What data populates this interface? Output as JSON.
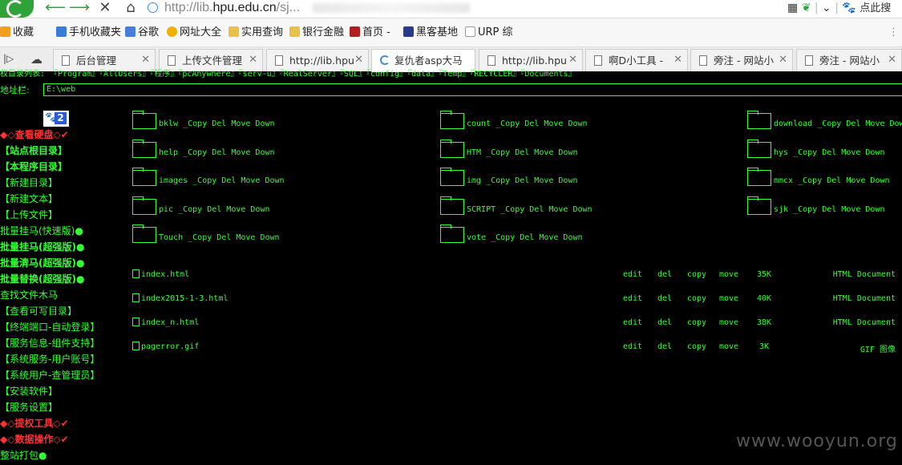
{
  "browser": {
    "url_host_prefix": "http://lib.",
    "url_host_main": "hpu.edu.cn",
    "url_tail": "/sj...",
    "search_placeholder": "点此搜",
    "bookmarks": [
      {
        "label": "收藏",
        "color": "#f0a020"
      },
      {
        "label": "手机收藏夹",
        "color": "#3a7bd5"
      },
      {
        "label": "谷歌",
        "color": "#4a7fd9"
      },
      {
        "label": "网址大全",
        "color": "#f0b000"
      },
      {
        "label": "实用查询",
        "color": "#e8c050"
      },
      {
        "label": "银行金融",
        "color": "#e8c050"
      },
      {
        "label": "首页 -",
        "color": "#b02020"
      },
      {
        "label": "黑客基地",
        "color": "#2a3a8a"
      },
      {
        "label": "URP 综",
        "color": "#999999"
      }
    ],
    "tabs": [
      {
        "label": "后台管理",
        "active": false
      },
      {
        "label": "上传文件管理",
        "active": false
      },
      {
        "label": "http://lib.hpu",
        "active": false
      },
      {
        "label": "复仇者asp大马",
        "active": true
      },
      {
        "label": "http://lib.hpu",
        "active": false
      },
      {
        "label": "啊D小工具 -",
        "active": false
      },
      {
        "label": "旁注 - 网站小",
        "active": false
      },
      {
        "label": "旁注 - 网站小",
        "active": false
      }
    ]
  },
  "page": {
    "dir_list": "权目录列表: 『Program』『AllUsers』『程序』『pcAnywhere』『serv-u』『RealServer』『SQL』『config』『data』『Temp』『RECYCLER』『Documents』",
    "address_label": "地址栏:",
    "address_value": "E:\\web",
    "badge": "2",
    "sidebar": [
      {
        "label": "◆◇查看硬盘◇✔",
        "style": "red"
      },
      {
        "label": "【站点根目录】",
        "style": "bold"
      },
      {
        "label": "【本程序目录】",
        "style": "bold"
      },
      {
        "label": "【新建目录】",
        "style": "normal"
      },
      {
        "label": "【新建文本】",
        "style": "normal"
      },
      {
        "label": "【上传文件】",
        "style": "normal"
      },
      {
        "label": "批量挂马(快速版)●",
        "style": "normal"
      },
      {
        "label": "批量挂马(超强版)●",
        "style": "bold"
      },
      {
        "label": "批量清马(超强版)●",
        "style": "bold"
      },
      {
        "label": "批量替换(超强版)●",
        "style": "bold"
      },
      {
        "label": "查找文件木马",
        "style": "normal"
      },
      {
        "label": "【查看可写目录】",
        "style": "normal"
      },
      {
        "label": "【终端端口-自动登录】",
        "style": "normal"
      },
      {
        "label": "【服务信息-组件支持】",
        "style": "normal"
      },
      {
        "label": "【系统服务-用户账号】",
        "style": "normal"
      },
      {
        "label": "【系统用户-查管理员】",
        "style": "normal"
      },
      {
        "label": "【安装软件】",
        "style": "normal"
      },
      {
        "label": "【服务设置】",
        "style": "normal"
      },
      {
        "label": "◆◇提权工具◇✔",
        "style": "red"
      },
      {
        "label": "◆◇数据操作◇✔",
        "style": "red"
      },
      {
        "label": "整站打包●",
        "style": "normal"
      }
    ],
    "folder_actions": "_Copy Del Move Down",
    "folders": [
      "bklw",
      "count",
      "download",
      "help",
      "HTM",
      "hys",
      "images",
      "img",
      "mmcx",
      "pic",
      "SCRIPT",
      "sjk",
      "Touch",
      "vote"
    ],
    "file_actions": [
      "edit",
      "del",
      "copy",
      "move"
    ],
    "files": [
      {
        "name": "index.html",
        "size": "35K",
        "type": "HTML Document"
      },
      {
        "name": "index2015-1-3.html",
        "size": "40K",
        "type": "HTML Document"
      },
      {
        "name": "index_n.html",
        "size": "38K",
        "type": "HTML Document"
      },
      {
        "name": "pagerror.gif",
        "size": "3K",
        "type": "GIF 图像"
      }
    ]
  },
  "watermark": "www.wooyun.org"
}
